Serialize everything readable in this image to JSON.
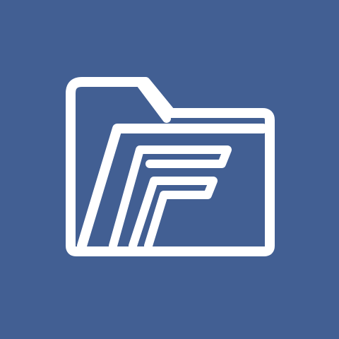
{
  "icon": {
    "name": "folder-f-logo-icon",
    "background_color": "#425f93",
    "foreground_color": "#ffffff"
  }
}
